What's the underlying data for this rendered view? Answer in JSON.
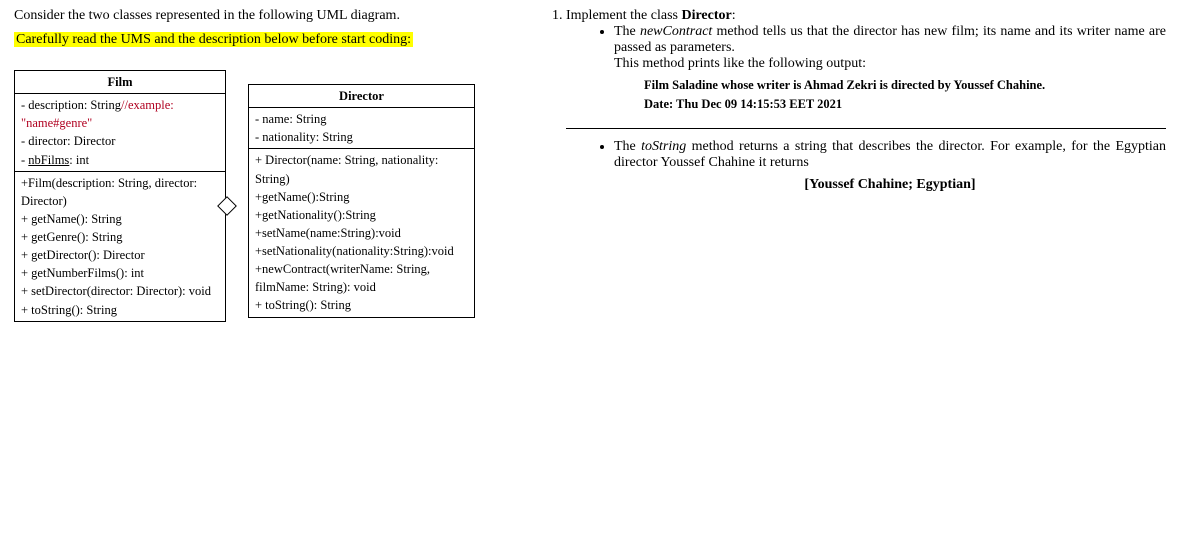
{
  "intro": "Consider the two classes represented in the following UML diagram.",
  "warning": "Carefully read the UMS and the description below before start coding:",
  "film": {
    "title": "Film",
    "attr_desc_prefix": "- description: String",
    "attr_desc_example_label": "//example:",
    "attr_desc_example_value": "\"name#genre\"",
    "attr_director": "- director: Director",
    "attr_nbfilms_prefix": "- ",
    "attr_nbfilms_name": "nbFilms",
    "attr_nbfilms_suffix": ": int",
    "ctor": "+Film(description: String, director: Director)",
    "m1": "+ getName(): String",
    "m2": "+ getGenre(): String",
    "m3": "+ getDirector(): Director",
    "m4": "+ getNumberFilms(): int",
    "m5": "+ setDirector(director: Director): void",
    "m6": "+ toString(): String"
  },
  "director": {
    "title": "Director",
    "attr_name": "- name: String",
    "attr_nat": "- nationality: String",
    "ctor": "+ Director(name: String, nationality: String)",
    "m1": "+getName():String",
    "m2": "+getNationality():String",
    "m3": "+setName(name:String):void",
    "m4": "+setNationality(nationality:String):void",
    "m5": "+newContract(writerName: String, filmName: String): void",
    "m6": "+ toString(): String"
  },
  "q1_lead": "Implement the class ",
  "q1_class": "Director",
  "q1_colon": ":",
  "b1_p1": "The ",
  "b1_method": "newContract",
  "b1_p2": " method tells us that the director has new film; its name and its writer name are passed as parameters.",
  "b1_line2": "This method prints like the following output:",
  "out_line1": "Film Saladine whose writer is Ahmad Zekri is directed by Youssef Chahine.",
  "out_line2": "Date: Thu Dec 09 14:15:53 EET 2021",
  "b2_p1": "The ",
  "b2_method": "toString",
  "b2_p2": " method returns a string that describes the director. For example, for the Egyptian director Youssef Chahine it returns",
  "b2_example": "[Youssef Chahine; Egyptian]"
}
